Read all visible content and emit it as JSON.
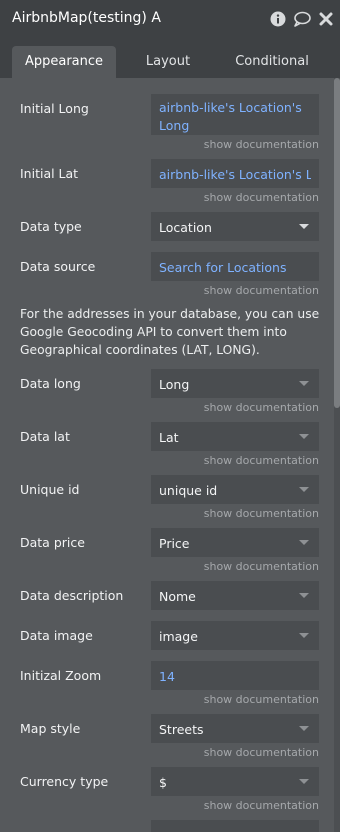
{
  "header": {
    "title": "AirbnbMap(testing) A",
    "icons": [
      "info-icon",
      "comment-icon",
      "close-icon"
    ]
  },
  "tabs": [
    "Appearance",
    "Layout",
    "Conditional"
  ],
  "active_tab": "Appearance",
  "doc_link": "show documentation",
  "geocode_note": "For the addresses in your database, you can use Google Geocoding API to convert them into Geographical coordinates (LAT, LONG).",
  "fields": {
    "initial_long": {
      "label": "Initial Long",
      "value": "airbnb-like's Location's Long"
    },
    "initial_lat": {
      "label": "Initial Lat",
      "value": "airbnb-like's Location's Lat"
    },
    "data_type": {
      "label": "Data type",
      "value": "Location"
    },
    "data_source": {
      "label": "Data source",
      "value": "Search for Locations"
    },
    "data_long": {
      "label": "Data long",
      "value": "Long"
    },
    "data_lat": {
      "label": "Data lat",
      "value": "Lat"
    },
    "unique_id": {
      "label": "Unique id",
      "value": "unique id"
    },
    "data_price": {
      "label": "Data price",
      "value": "Price"
    },
    "data_description": {
      "label": "Data description",
      "value": "Nome"
    },
    "data_image": {
      "label": "Data image",
      "value": "image"
    },
    "initial_zoom": {
      "label": "Initizal Zoom",
      "value": "14"
    },
    "map_style": {
      "label": "Map style",
      "value": "Streets"
    },
    "currency_type": {
      "label": "Currency type",
      "value": "$"
    }
  },
  "colors": {
    "panel": "#56595c",
    "header": "#3e4144",
    "field": "#4a4d50",
    "link": "#7fb2ff"
  }
}
